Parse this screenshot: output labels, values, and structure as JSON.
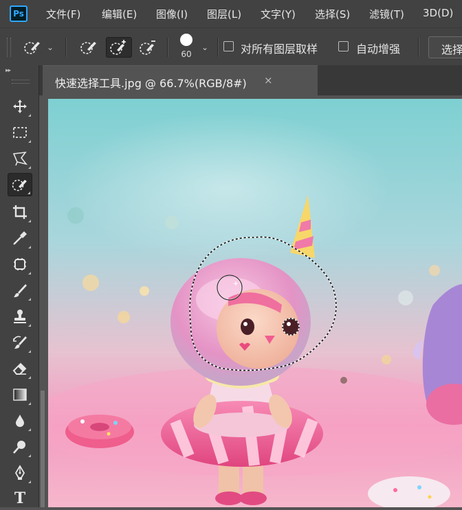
{
  "app": {
    "logo_text": "Ps"
  },
  "menu": [
    {
      "label": "文件(F)"
    },
    {
      "label": "编辑(E)"
    },
    {
      "label": "图像(I)"
    },
    {
      "label": "图层(L)"
    },
    {
      "label": "文字(Y)"
    },
    {
      "label": "选择(S)"
    },
    {
      "label": "滤镜(T)"
    },
    {
      "label": "3D(D)"
    }
  ],
  "options": {
    "brush_size": "60",
    "sample_all_layers_label": "对所有图层取样",
    "sample_all_layers_checked": false,
    "auto_enhance_label": "自动增强",
    "auto_enhance_checked": false,
    "select_subject_label": "选择",
    "selection_modes": [
      "new-selection",
      "add-to-selection",
      "subtract-from-selection"
    ],
    "active_mode": "add-to-selection"
  },
  "document": {
    "tab_title": "快速选择工具.jpg @ 66.7%(RGB/8#)",
    "close_glyph": "×",
    "zoom": "66.7%"
  },
  "tools": [
    {
      "name": "move-tool",
      "icon": "move-icon"
    },
    {
      "name": "marquee-tool",
      "icon": "rect-marquee-icon"
    },
    {
      "name": "lasso-tool",
      "icon": "polygonal-lasso-icon"
    },
    {
      "name": "quick-selection-tool",
      "icon": "quick-selection-icon",
      "active": true
    },
    {
      "name": "crop-tool",
      "icon": "crop-icon"
    },
    {
      "name": "eyedropper-tool",
      "icon": "eyedropper-icon"
    },
    {
      "name": "healing-brush-tool",
      "icon": "healing-icon"
    },
    {
      "name": "brush-tool",
      "icon": "brush-icon"
    },
    {
      "name": "clone-stamp-tool",
      "icon": "stamp-icon"
    },
    {
      "name": "history-brush-tool",
      "icon": "history-brush-icon"
    },
    {
      "name": "eraser-tool",
      "icon": "eraser-icon"
    },
    {
      "name": "gradient-tool",
      "icon": "gradient-icon"
    },
    {
      "name": "blur-tool",
      "icon": "blur-drop-icon"
    },
    {
      "name": "dodge-tool",
      "icon": "dodge-icon"
    },
    {
      "name": "pen-tool",
      "icon": "pen-icon"
    },
    {
      "name": "type-tool",
      "icon": "type-icon",
      "glyph": "T"
    }
  ],
  "colors": {
    "menubar": "#424242",
    "workspace": "#535353",
    "accent": "#31a8ff"
  }
}
